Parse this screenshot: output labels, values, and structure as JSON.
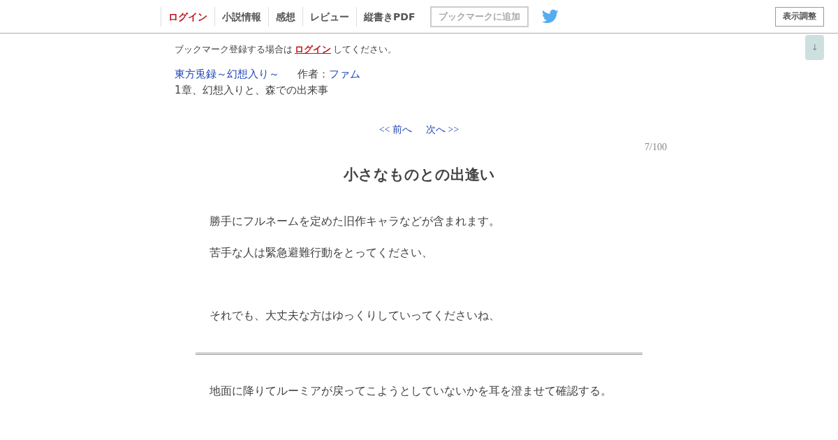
{
  "header": {
    "nav": [
      {
        "label": "ログイン",
        "kind": "login"
      },
      {
        "label": "小説情報",
        "kind": "link"
      },
      {
        "label": "感想",
        "kind": "link"
      },
      {
        "label": "レビュー",
        "kind": "link"
      },
      {
        "label": "縦書きPDF",
        "kind": "link"
      }
    ],
    "bookmark_button": {
      "label": "ブックマークに追加",
      "disabled": true
    },
    "display_button": {
      "label": "表示調整"
    }
  },
  "scroll_button": {
    "label": "↓"
  },
  "notice": {
    "text_before": "ブックマーク登録する場合は",
    "link": "ログイン",
    "text_after": "してください。"
  },
  "novel": {
    "title": "東方兎録～幻想入り～",
    "author_label": "作者：",
    "author": "ファム",
    "chapter": "1章、幻想入りと、森での出来事"
  },
  "pager": {
    "prev": "<< 前へ",
    "next": "次へ >>",
    "count": "7/100"
  },
  "episode": {
    "title": "小さなものとの出逢い",
    "preface": [
      {
        "lines": [
          "勝手にフルネームを定めた旧作キャラなどが含まれます。",
          "苦手な人は緊急避難行動をとってください、"
        ]
      },
      {
        "lines": [
          "それでも、大丈夫な方はゆっくりしていってくださいね、"
        ]
      }
    ],
    "body": [
      "地面に降りてルーミアが戻ってこようとしていないかを耳を澄ませて確認する。"
    ]
  }
}
